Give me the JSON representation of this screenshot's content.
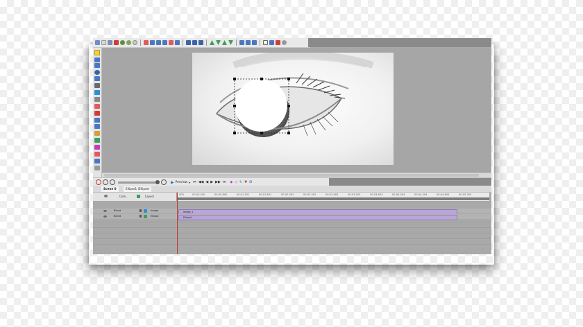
{
  "toolbar": {
    "icons": [
      "new-icon",
      "open-icon",
      "save-icon",
      "delete-icon",
      "undo-icon",
      "redo-icon",
      "align-icon",
      "distribute-icon",
      "arrange-icon",
      "move-up-icon",
      "move-down-icon",
      "export-icon",
      "settings-icon"
    ]
  },
  "left_tools": [
    "select-tool-icon",
    "pen-tool-icon",
    "rectangle-tool-icon",
    "ellipse-tool-icon",
    "text-tool-icon",
    "image-tool-icon",
    "shape-tool-icon",
    "brush-tool-icon",
    "fill-tool-icon",
    "eyedropper-tool-icon",
    "hand-tool-icon"
  ],
  "playback": {
    "preview_label": "Preview"
  },
  "tabs": [
    {
      "label": "Scene 0"
    },
    {
      "label": "Ellipse1 (Ellipse)"
    }
  ],
  "timeline": {
    "header": {
      "com_label": "Com...",
      "layers_label": "Layers"
    },
    "ruler_labels": [
      "000",
      "00:00.400",
      "00:00.800",
      "00:01.201",
      "00:01.601",
      "00:02.002",
      "00:02.402",
      "00:02.803",
      "00:03.203",
      "00:03.603",
      "00:04.004",
      "00:04.404",
      "00:04.804",
      "00:05.205"
    ],
    "rows": [
      {
        "blend": "Blend",
        "layer": "Image",
        "clip": "image_1"
      },
      {
        "blend": "Blend",
        "layer": "Ellipse",
        "clip": "Ellipse1"
      }
    ]
  },
  "colors": {
    "accent": "#3a6ea5",
    "track": "#b9a6d6",
    "playhead": "#c0392b"
  }
}
